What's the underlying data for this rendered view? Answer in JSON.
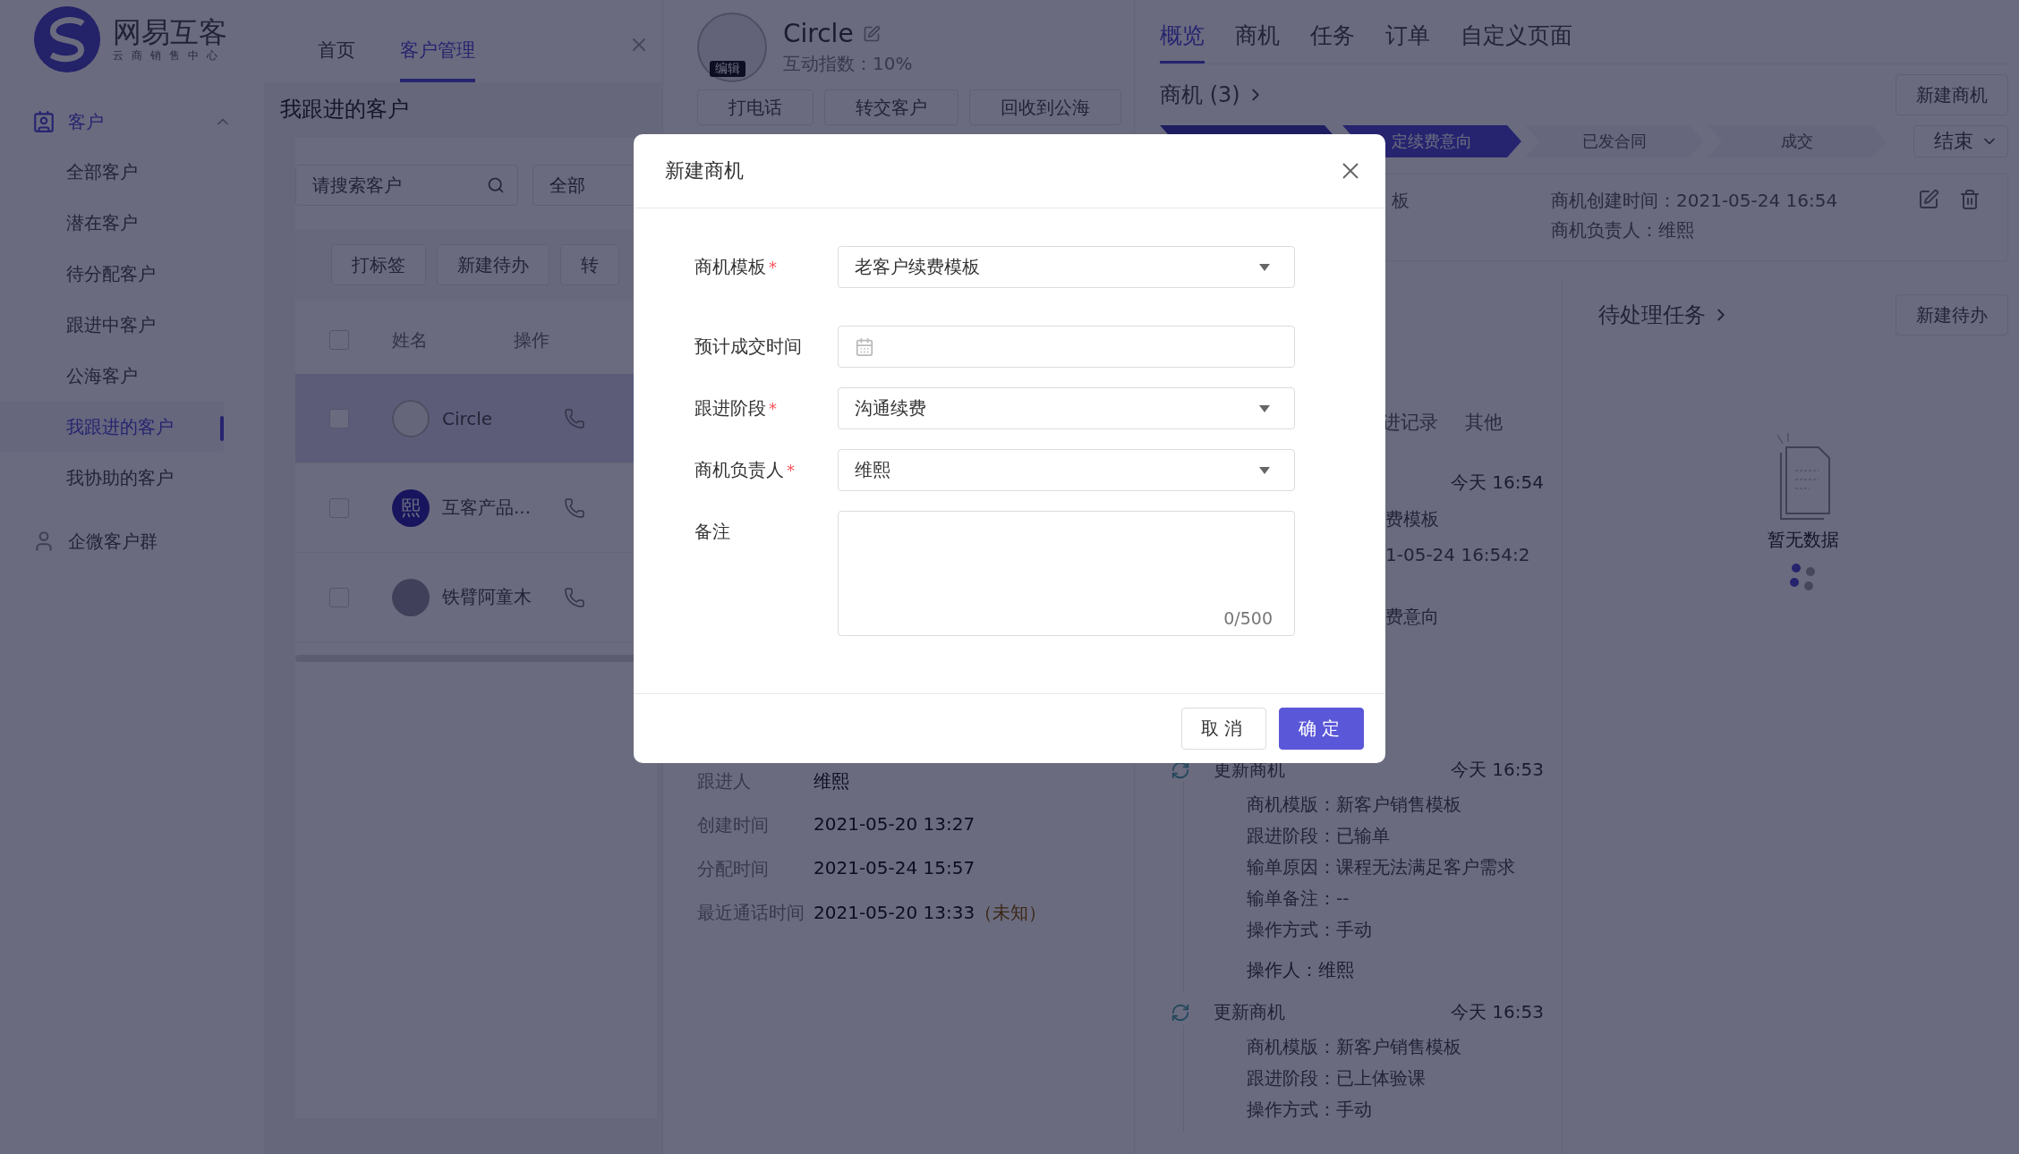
{
  "logo": {
    "name": "网易互客",
    "subtitle": "云商销售中心"
  },
  "sidebar": {
    "sections": [
      {
        "kind": "group",
        "label": "客户",
        "expanded": true,
        "items": [
          {
            "label": "全部客户",
            "selected": false
          },
          {
            "label": "潜在客户",
            "selected": false
          },
          {
            "label": "待分配客户",
            "selected": false
          },
          {
            "label": "跟进中客户",
            "selected": false
          },
          {
            "label": "公海客户",
            "selected": false
          },
          {
            "label": "我跟进的客户",
            "selected": true
          },
          {
            "label": "我协助的客户",
            "selected": false
          }
        ]
      },
      {
        "kind": "link",
        "label": "企微客户群"
      }
    ]
  },
  "top_tabs": [
    {
      "label": "首页",
      "selected": false
    },
    {
      "label": "客户管理",
      "selected": true
    }
  ],
  "customer_list": {
    "title": "我跟进的客户",
    "search": {
      "placeholder": "请搜索客户"
    },
    "filter": "全部",
    "actions": [
      "打标签",
      "新建待办",
      "转"
    ],
    "columns": [
      "姓名",
      "操作"
    ],
    "all_checked": false,
    "rows": [
      {
        "name": "Circle",
        "kind": "sketch",
        "checked": false,
        "selected": true
      },
      {
        "name": "互客产品...",
        "kind": "letter",
        "avatar_text": "熙",
        "checked": false,
        "selected": false
      },
      {
        "name": "铁臂阿童木",
        "kind": "photo",
        "checked": false,
        "selected": false
      }
    ]
  },
  "customer_detail": {
    "name": "Circle",
    "avatar_label": "编辑",
    "interaction": "互动指数：10%",
    "actions": [
      "打电话",
      "转交客户",
      "回收到公海"
    ],
    "fields": [
      {
        "label": "跟进人",
        "value": "维熙"
      },
      {
        "label": "创建时间",
        "value": "2021-05-20 13:27"
      },
      {
        "label": "分配时间",
        "value": "2021-05-24 15:57"
      },
      {
        "label": "最近通话时间",
        "value": "2021-05-20 13:33",
        "note": "（未知）"
      }
    ]
  },
  "detail_tabs": [
    {
      "label": "概览",
      "selected": true
    },
    {
      "label": "商机",
      "selected": false
    },
    {
      "label": "任务",
      "selected": false
    },
    {
      "label": "订单",
      "selected": false
    },
    {
      "label": "自定义页面",
      "selected": false
    }
  ],
  "opportunities": {
    "title": "商机 (3)",
    "new_button": "新建商机",
    "stages": [
      {
        "kind": "done"
      },
      {
        "kind": "current",
        "label": "定续费意向"
      },
      {
        "kind": "todo",
        "label": "已发合同"
      },
      {
        "kind": "todo",
        "label": "成交"
      }
    ],
    "end_dropdown": "结束",
    "card": {
      "fragment": "板",
      "created": "商机创建时间：2021-05-24 16:54",
      "owner": "商机负责人：维熙"
    }
  },
  "timeline": {
    "tabs": [
      "进记录",
      "其他"
    ],
    "first_entry": {
      "time": "今天 16:54",
      "lines": [
        "费模板",
        "1-05-24 16:54:2",
        "费意向"
      ]
    },
    "entries": [
      {
        "title": "更新商机",
        "time": "今天 16:53",
        "lines": [
          "商机模版：新客户销售模板",
          "跟进阶段：已输单",
          "输单原因：课程无法满足客户需求",
          "输单备注：--",
          "操作方式：手动"
        ],
        "operator": "操作人：维熙"
      },
      {
        "title": "更新商机",
        "time": "今天 16:53",
        "lines": [
          "商机模版：新客户销售模板",
          "跟进阶段：已上体验课",
          "操作方式：手动"
        ]
      }
    ]
  },
  "tasks": {
    "title": "待处理任务",
    "new_button": "新建待办",
    "empty": "暂无数据"
  },
  "modal": {
    "title": "新建商机",
    "required_mark": "*",
    "fields": [
      {
        "kind": "select",
        "label": "商机模板",
        "required": true,
        "value": "老客户续费模板"
      },
      {
        "kind": "date",
        "label": "预计成交时间",
        "required": false
      },
      {
        "kind": "select",
        "label": "跟进阶段",
        "required": true,
        "value": "沟通续费"
      },
      {
        "kind": "select",
        "label": "商机负责人",
        "required": true,
        "value": "维熙"
      },
      {
        "kind": "textarea",
        "label": "备注",
        "required": false,
        "counter": "0/500"
      }
    ],
    "buttons": [
      {
        "kind": "secondary",
        "label": "取消"
      },
      {
        "kind": "primary",
        "label": "确定"
      }
    ]
  }
}
